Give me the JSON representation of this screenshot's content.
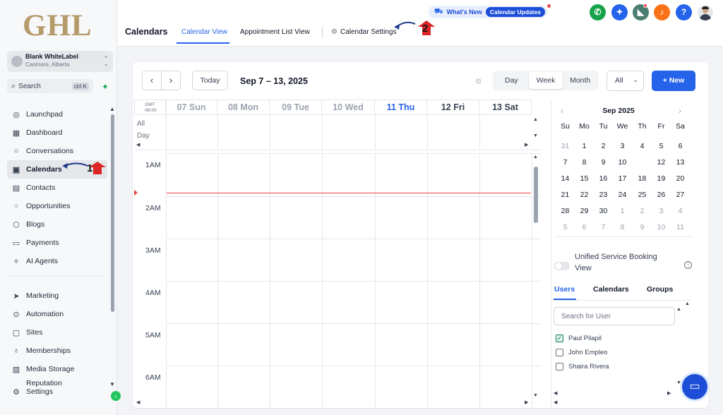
{
  "brand": {
    "logo_text": "GHL"
  },
  "account": {
    "name": "Blank WhiteLabel",
    "location": "Canmore, Alberta"
  },
  "search": {
    "label": "Search",
    "shortcut": "ctrl K"
  },
  "sidebar": {
    "items": [
      {
        "label": "Launchpad",
        "icon": "rocket-icon"
      },
      {
        "label": "Dashboard",
        "icon": "grid-icon"
      },
      {
        "label": "Conversations",
        "icon": "chat-icon"
      },
      {
        "label": "Calendars",
        "icon": "calendar-icon",
        "active": true
      },
      {
        "label": "Contacts",
        "icon": "contacts-icon"
      },
      {
        "label": "Opportunities",
        "icon": "opportunities-icon"
      },
      {
        "label": "Blogs",
        "icon": "blog-icon"
      },
      {
        "label": "Payments",
        "icon": "payments-icon"
      },
      {
        "label": "AI Agents",
        "icon": "sparkle-icon"
      }
    ],
    "items2": [
      {
        "label": "Marketing",
        "icon": "send-icon"
      },
      {
        "label": "Automation",
        "icon": "automation-icon"
      },
      {
        "label": "Sites",
        "icon": "sites-icon"
      },
      {
        "label": "Memberships",
        "icon": "membership-icon"
      },
      {
        "label": "Media Storage",
        "icon": "image-icon"
      },
      {
        "label": "Reputation",
        "icon": "reputation-icon"
      },
      {
        "label": "Settings",
        "icon": "gear-icon"
      }
    ]
  },
  "header": {
    "title": "Calendars",
    "tabs": [
      "Calendar View",
      "Appointment List View",
      "Calendar Settings"
    ],
    "whats_new": "What's New",
    "whats_new_badge": "Calendar Updates"
  },
  "annotations": {
    "one": "1",
    "two": "2"
  },
  "toolbar": {
    "prev": "‹",
    "next": "›",
    "today": "Today",
    "range": "Sep 7 – 13, 2025",
    "views": [
      "Day",
      "Week",
      "Month"
    ],
    "selected_view": "Week",
    "filter": "All",
    "new_label": "+ New"
  },
  "grid": {
    "timezone_line1": "GMT",
    "timezone_line2": "-06:00",
    "days": [
      "07 Sun",
      "08 Mon",
      "09 Tue",
      "10 Wed",
      "11 Thu",
      "12 Fri",
      "13 Sat"
    ],
    "today_index": 4,
    "all_day_label_1": "All",
    "all_day_label_2": "Day",
    "hours": [
      "1AM",
      "2AM",
      "3AM",
      "4AM",
      "5AM",
      "6AM"
    ]
  },
  "mini_calendar": {
    "month": "Sep 2025",
    "weekdays": [
      "Su",
      "Mo",
      "Tu",
      "We",
      "Th",
      "Fr",
      "Sa"
    ],
    "weeks": [
      [
        "31",
        "1",
        "2",
        "3",
        "4",
        "5",
        "6"
      ],
      [
        "7",
        "8",
        "9",
        "10",
        "11",
        "12",
        "13"
      ],
      [
        "14",
        "15",
        "16",
        "17",
        "18",
        "19",
        "20"
      ],
      [
        "21",
        "22",
        "23",
        "24",
        "25",
        "26",
        "27"
      ],
      [
        "28",
        "29",
        "30",
        "1",
        "2",
        "3",
        "4"
      ],
      [
        "5",
        "6",
        "7",
        "8",
        "9",
        "10",
        "11"
      ]
    ],
    "today": "11"
  },
  "right_panel": {
    "unified_label": "Unified Service Booking View",
    "unified_on": false,
    "tabs": [
      "Users",
      "Calendars",
      "Groups"
    ],
    "search_placeholder": "Search for User",
    "users": [
      {
        "name": "Paul Pilapil",
        "checked": true
      },
      {
        "name": "John Empleo",
        "checked": false
      },
      {
        "name": "Shaira Rivera",
        "checked": false
      }
    ]
  },
  "colors": {
    "accent": "#2563eb",
    "now_line": "#ef4444",
    "logo": "#b59a6a"
  }
}
